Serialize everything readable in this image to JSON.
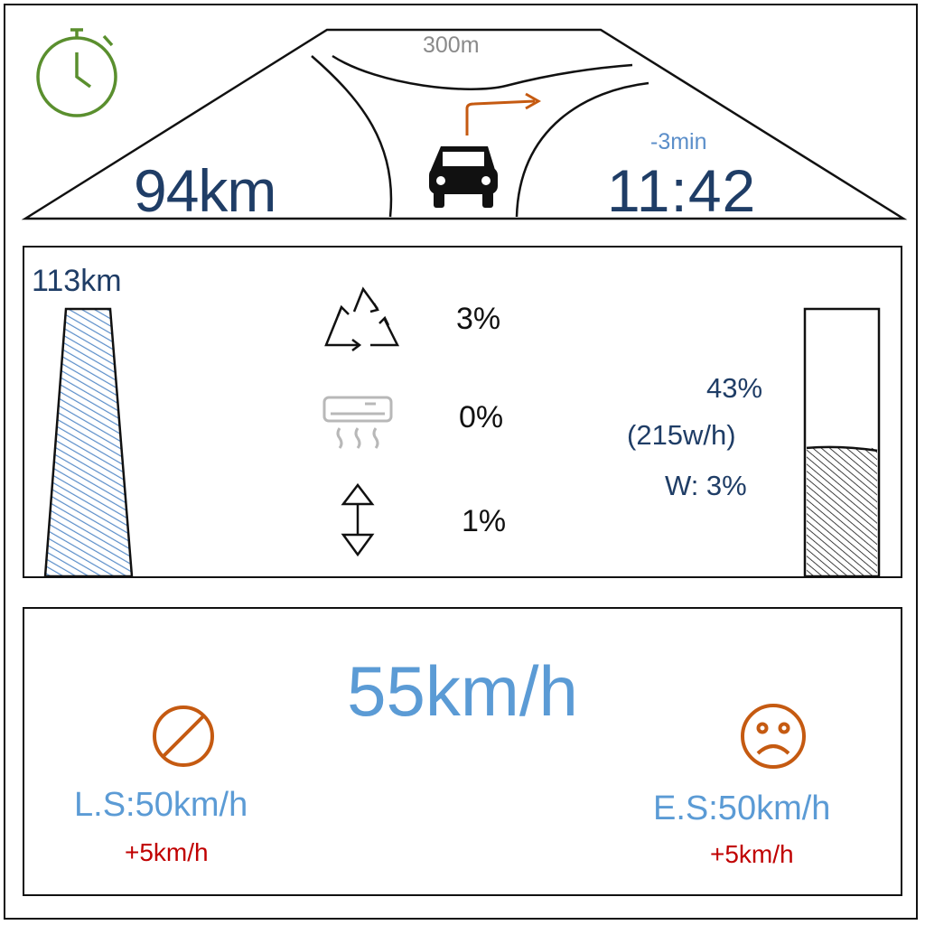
{
  "navigation": {
    "turn_distance": "300m",
    "distance_remaining": "94km",
    "arrival_time": "11:42",
    "time_delta": "-3min",
    "icons": {
      "timer": "stopwatch-icon",
      "vehicle": "car-icon",
      "turn": "turn-right-arrow-icon"
    },
    "colors": {
      "timer": "#5a8f2e",
      "turn_arrow": "#c55a11"
    }
  },
  "energy": {
    "range": "113km",
    "consumers": [
      {
        "icon": "recycle-icon",
        "value": "3%"
      },
      {
        "icon": "air-conditioner-icon",
        "value": "0%"
      },
      {
        "icon": "up-down-arrow-icon",
        "value": "1%"
      }
    ],
    "battery": {
      "percent_label": "43%",
      "power_label": "(215w/h)",
      "waste_label": "W: 3%",
      "level": 0.48
    },
    "range_gauge_level": 1.0
  },
  "speed": {
    "current": "55km/h",
    "limit": {
      "icon": "no-entry-icon",
      "label": "L.S:50km/h",
      "delta": "+5km/h"
    },
    "eco": {
      "icon": "sad-face-icon",
      "label": "E.S:50km/h",
      "delta": "+5km/h"
    },
    "colors": {
      "speed": "#5b9bd5",
      "warning_icon": "#c55a11",
      "delta": "#c00000"
    }
  }
}
